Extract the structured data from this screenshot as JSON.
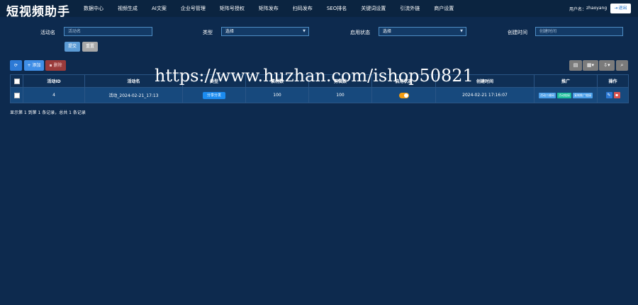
{
  "brand": "短视频助手",
  "nav": [
    "数据中心",
    "视频生成",
    "AI文案",
    "企业号管理",
    "矩阵号授权",
    "矩阵发布",
    "扫码发布",
    "SEO排名",
    "关键词设置",
    "引流外链",
    "商户设置"
  ],
  "user": {
    "label": "用户名：",
    "name": "zhaoyang",
    "logout": "退出",
    "logout_icon": "logout-icon"
  },
  "filters": {
    "name_label": "活动名",
    "name_placeholder": "活动名",
    "type_label": "类型",
    "type_value": "选择",
    "status_label": "启用状态",
    "status_value": "选择",
    "time_label": "创建时间",
    "time_placeholder": "创建时间",
    "submit": "提交",
    "reset": "重置"
  },
  "toolbar": {
    "refresh_icon": "refresh-icon",
    "add": "+ 添加",
    "delete": "删除",
    "right_buttons": [
      "table-icon",
      "grid-icon",
      "export-icon",
      "search-icon"
    ]
  },
  "table": {
    "headers": [
      "活动ID",
      "活动名",
      "类型",
      "素材数",
      "剪辑数",
      "启用状态",
      "创建时间",
      "推广",
      "操作"
    ],
    "rows": [
      {
        "id": "4",
        "name": "活动_2024-02-21_17:13",
        "type": "分享分发",
        "materials": "100",
        "clips": "100",
        "enabled": true,
        "created": "2024-02-21 17:16:07",
        "promo": [
          "活动二维码",
          "活动链接",
          "复制推广链接"
        ]
      }
    ]
  },
  "summary": "显示第 1 到第 1 条记录，总共 1 条记录",
  "watermark": "https://www.huzhan.com/ishop50821",
  "colors": {
    "background": "#0d2a4e",
    "primary": "#2d7ad6",
    "toggle": "#f39c12",
    "danger": "#d9534f"
  }
}
